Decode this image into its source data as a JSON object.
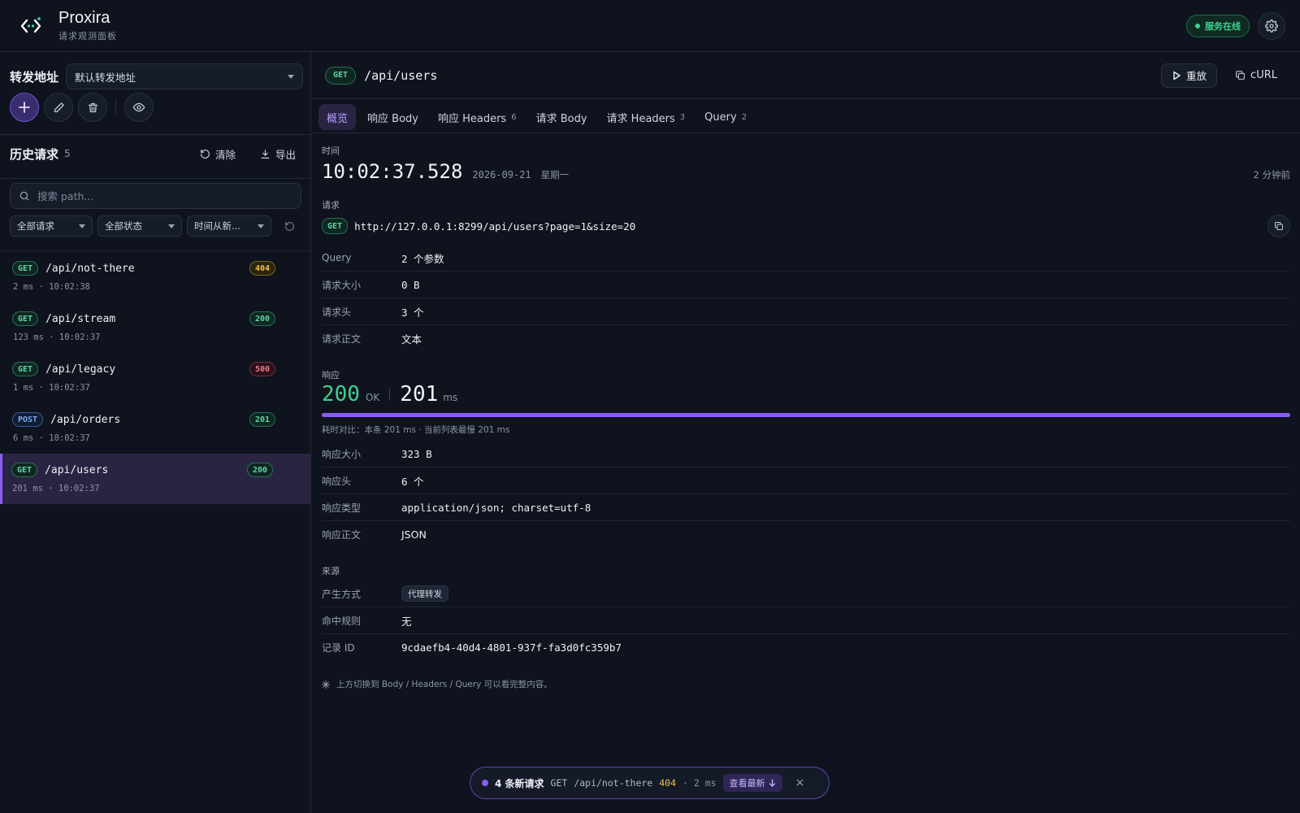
{
  "app": {
    "name": "Proxira",
    "subtitle": "请求观测面板",
    "status": "服务在线"
  },
  "sidebar": {
    "forward_label": "转发地址",
    "forward_select": "默认转发地址",
    "history_title": "历史请求",
    "history_count": "5",
    "clear_label": "清除",
    "export_label": "导出",
    "search_placeholder": "搜索 path...",
    "filters": [
      "全部请求",
      "全部状态",
      "时间从新..."
    ],
    "requests": [
      {
        "method": "GET",
        "path": "/api/not-there",
        "status": "404",
        "status_kind": "warn",
        "duration": "2 ms",
        "time": "10:02:38"
      },
      {
        "method": "GET",
        "path": "/api/stream",
        "status": "200",
        "status_kind": "ok",
        "duration": "123 ms",
        "time": "10:02:37"
      },
      {
        "method": "GET",
        "path": "/api/legacy",
        "status": "500",
        "status_kind": "err",
        "duration": "1 ms",
        "time": "10:02:37"
      },
      {
        "method": "POST",
        "path": "/api/orders",
        "status": "201",
        "status_kind": "ok",
        "duration": "6 ms",
        "time": "10:02:37"
      },
      {
        "method": "GET",
        "path": "/api/users",
        "status": "200",
        "status_kind": "ok",
        "duration": "201 ms",
        "time": "10:02:37",
        "active": true
      }
    ]
  },
  "detail": {
    "method": "GET",
    "path": "/api/users",
    "replay_label": "重放",
    "curl_label": "cURL",
    "tabs": [
      {
        "label": "概览",
        "count": ""
      },
      {
        "label": "响应 Body",
        "count": ""
      },
      {
        "label": "响应 Headers",
        "count": "6"
      },
      {
        "label": "请求 Body",
        "count": ""
      },
      {
        "label": "请求 Headers",
        "count": "3"
      },
      {
        "label": "Query",
        "count": "2"
      }
    ],
    "time_label": "时间",
    "time": "10:02:37.528",
    "date": "2026-09-21",
    "weekday": "星期一",
    "ago": "2 分钟前",
    "request_label": "请求",
    "url": "http://127.0.0.1:8299/api/users?page=1&size=20",
    "request_rows": [
      {
        "key": "Query",
        "value": "2 个参数"
      },
      {
        "key": "请求大小",
        "value": "0 B"
      },
      {
        "key": "请求头",
        "value": "3 个"
      },
      {
        "key": "请求正文",
        "value": "文本"
      }
    ],
    "response_label": "响应",
    "status_code": "200",
    "status_text": "OK",
    "duration": "201",
    "duration_unit": "ms",
    "duration_ratio": 1.0,
    "compare_note": "耗时对比：本条 201 ms · 当前列表最慢 201 ms",
    "response_rows": [
      {
        "key": "响应大小",
        "value": "323 B"
      },
      {
        "key": "响应头",
        "value": "6 个"
      },
      {
        "key": "响应类型",
        "value": "application/json; charset=utf-8"
      },
      {
        "key": "响应正文",
        "value": "JSON"
      }
    ],
    "source_label": "来源",
    "source_rows": {
      "mode_key": "产生方式",
      "mode_value": "代理转发",
      "rule_key": "命中规则",
      "rule_value": "无",
      "id_key": "记录 ID",
      "id_value": "9cdaefb4-40d4-4801-937f-fa3d0fc359b7"
    },
    "hint": "上方切换到 Body / Headers / Query 可以看完整内容。"
  },
  "toast": {
    "count_text": "4 条新请求",
    "method": "GET",
    "path": "/api/not-there",
    "status": "404",
    "ms": "· 2 ms",
    "button": "查看最新",
    "close": "×"
  },
  "colors": {
    "accent": "#8b5cf6",
    "ok": "#3fd08f",
    "warn": "#f0c24a",
    "error": "#f07a8c",
    "background": "#0e131e"
  }
}
